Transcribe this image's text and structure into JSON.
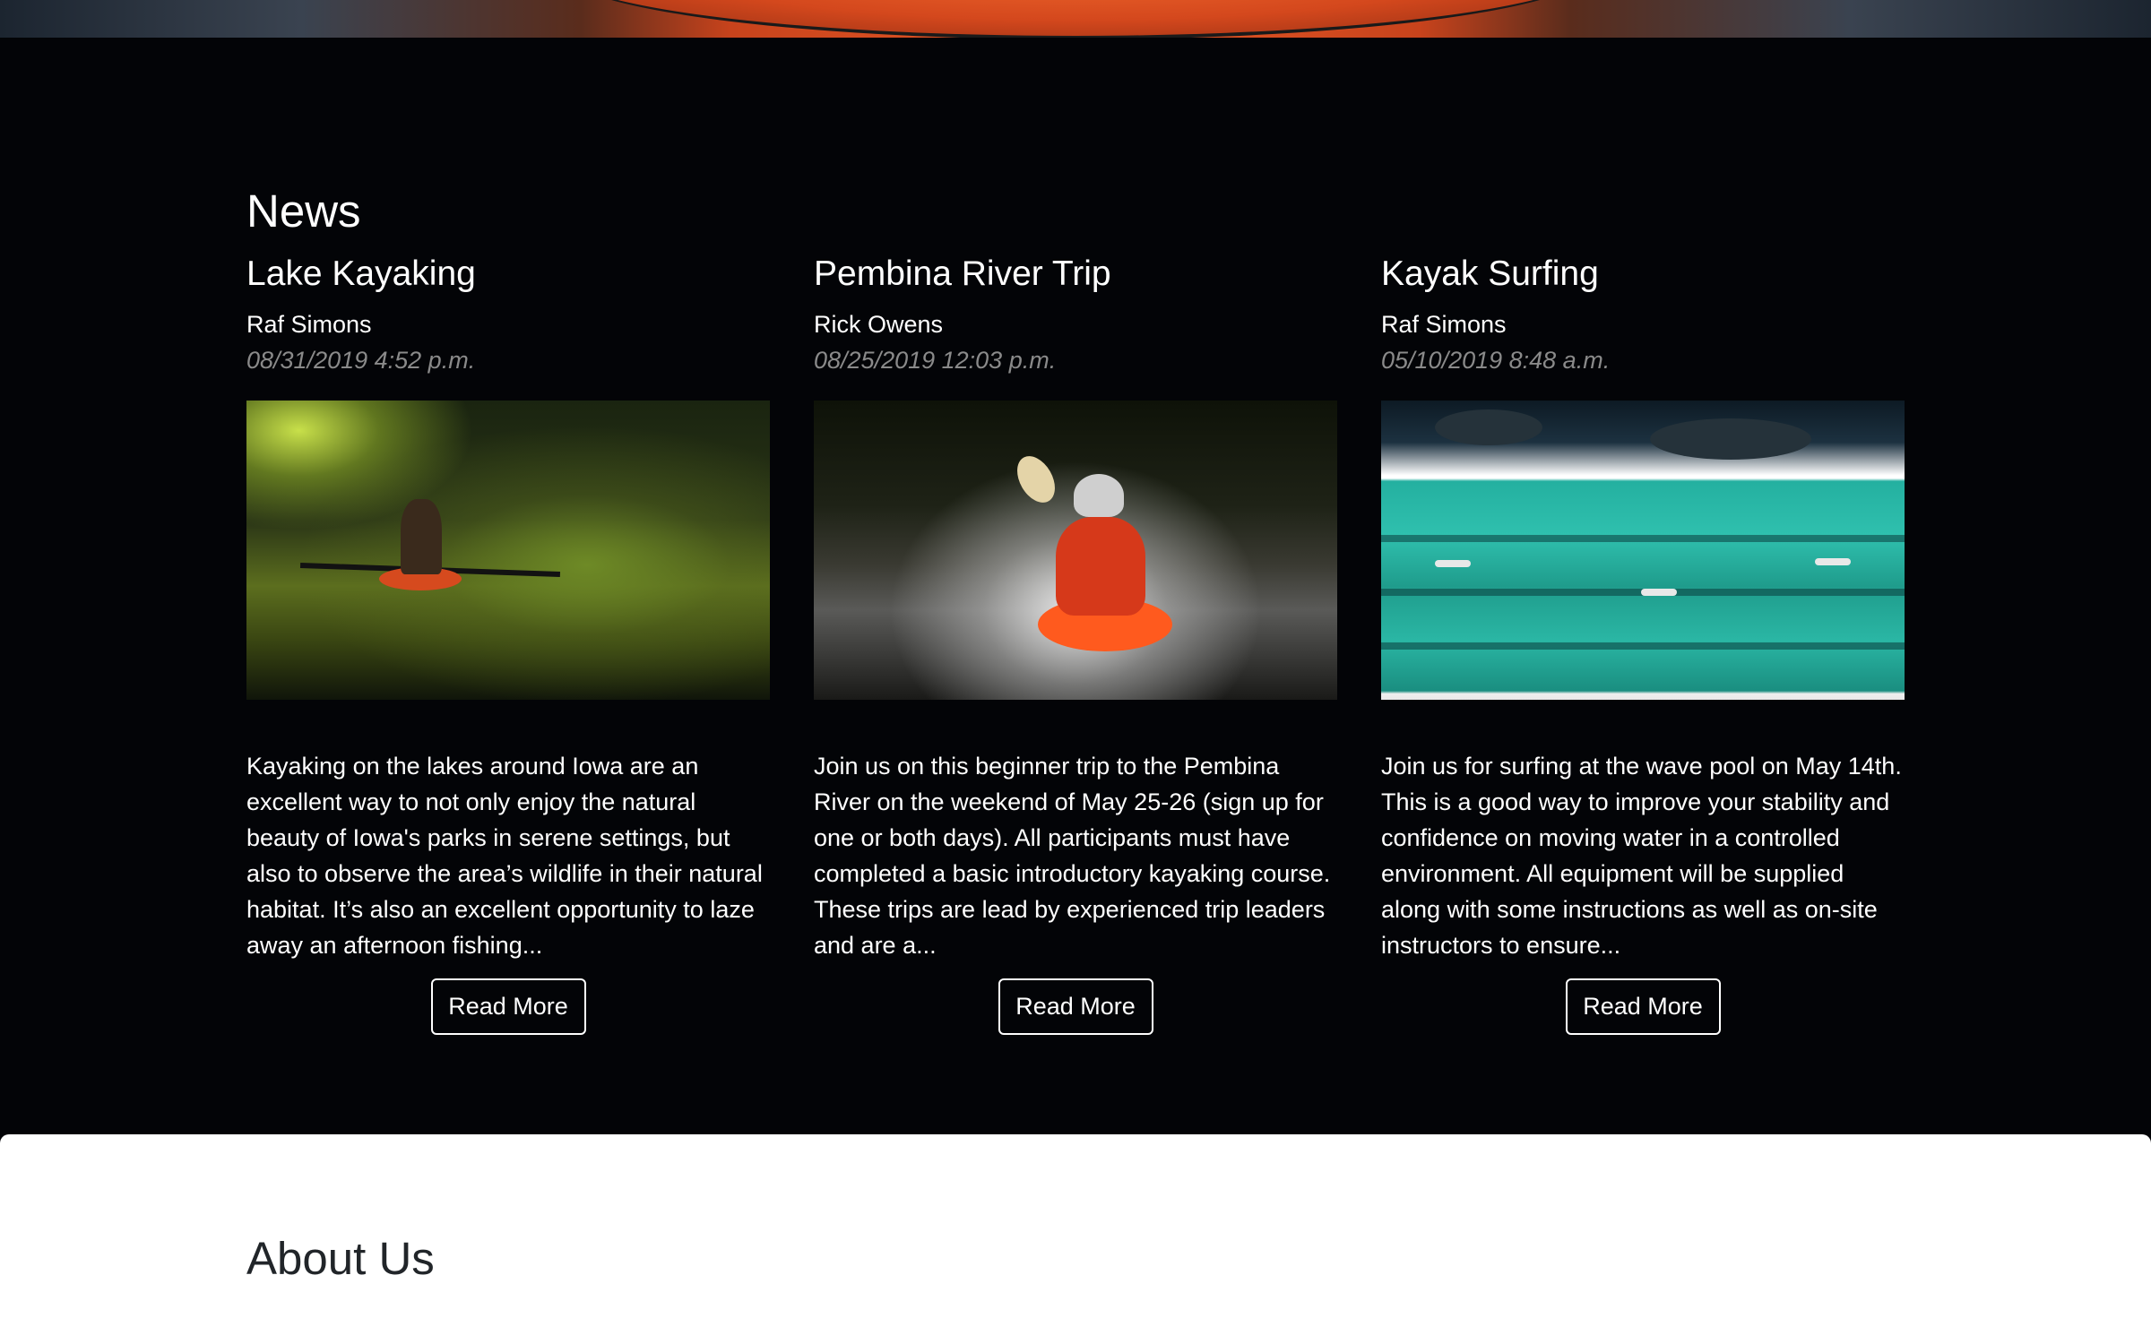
{
  "news": {
    "heading": "News",
    "articles": [
      {
        "title": "Lake Kayaking",
        "author": "Raf Simons",
        "date": "08/31/2019 4:52 p.m.",
        "excerpt": "Kayaking on the lakes around Iowa are an excellent way to not only enjoy the natural beauty of Iowa's parks in serene settings, but also to observe the area’s wildlife in their natural habitat. It’s also an excellent opportunity to laze away an afternoon fishing...",
        "button_label": "Read More"
      },
      {
        "title": "Pembina River Trip",
        "author": "Rick Owens",
        "date": "08/25/2019 12:03 p.m.",
        "excerpt": "Join us on this beginner trip to the Pembina River on the weekend of May 25-26 (sign up for one or both days). All participants must have completed a basic introductory kayaking course. These trips are lead by experienced trip leaders and are a...",
        "button_label": "Read More"
      },
      {
        "title": "Kayak Surfing",
        "author": "Raf Simons",
        "date": "05/10/2019 8:48 a.m.",
        "excerpt": "Join us for surfing at the wave pool on May 14th. This is a good way to improve your stability and confidence on moving water in a controlled environment. All equipment will be supplied along with some instructions as well as on-site instructors to ensure...",
        "button_label": "Read More"
      }
    ]
  },
  "about": {
    "heading": "About Us"
  },
  "colors": {
    "page_background": "#030407",
    "text_primary": "#ffffff",
    "text_date": "#8a8a8a",
    "about_background": "#ffffff",
    "about_heading": "#212529"
  }
}
